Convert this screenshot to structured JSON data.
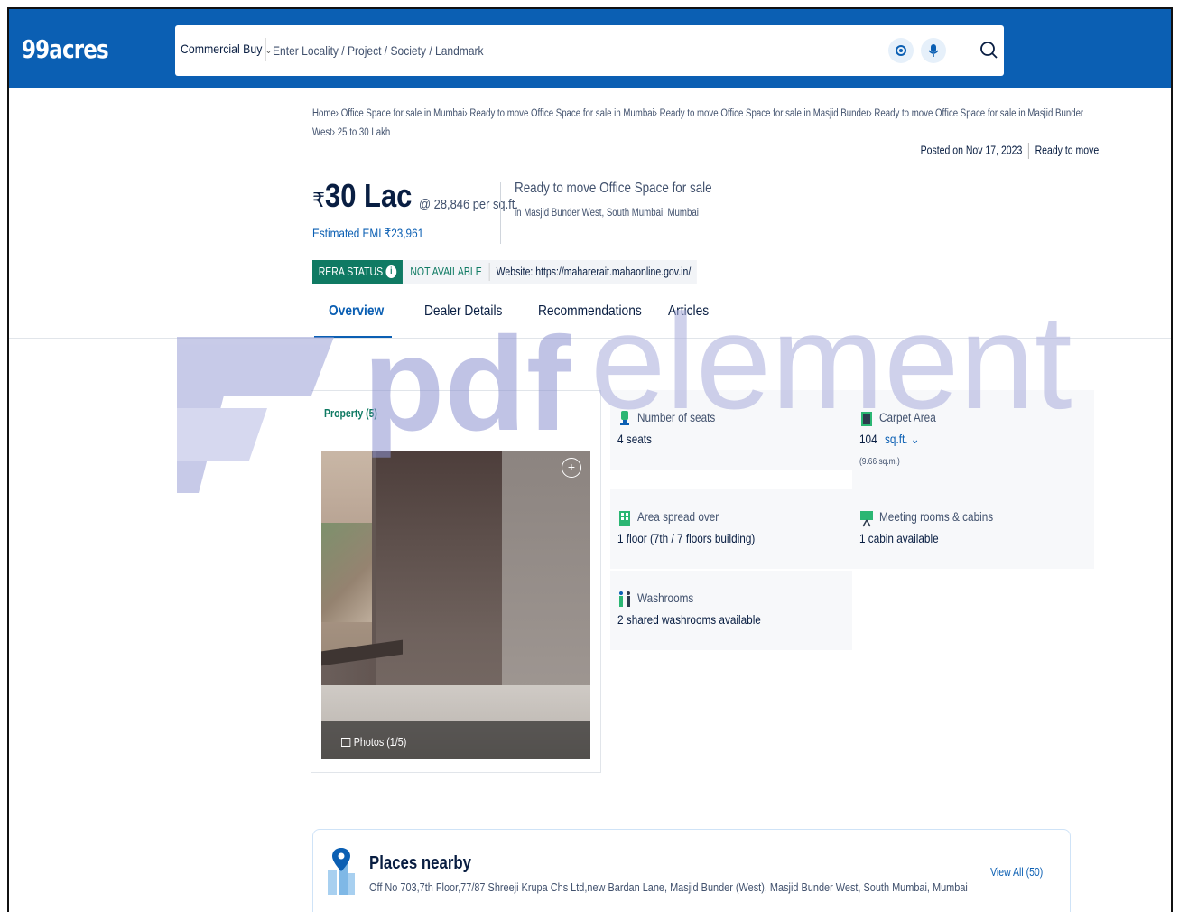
{
  "header": {
    "logo": "99acres",
    "category_select": "Commercial Buy",
    "search_placeholder": "Enter Locality / Project / Society / Landmark"
  },
  "breadcrumb": {
    "items": [
      "Home",
      "Office Space for sale in Mumbai",
      "Ready to move Office Space for sale in Mumbai",
      "Ready to move Office Space for sale in Masjid Bunder",
      "Ready to move Office Space for sale in Masjid Bunder West",
      "25 to 30 Lakh"
    ],
    "separator": "›"
  },
  "posted": {
    "date": "Posted on Nov 17, 2023",
    "status": "Ready to move"
  },
  "price": {
    "currency": "₹",
    "amount": "30 Lac",
    "per_sqft": "@ 28,846 per sq.ft.",
    "emi": "Estimated EMI ₹23,961"
  },
  "listing": {
    "title": "Ready to move Office Space for sale",
    "location": "in Masjid Bunder West, South Mumbai, Mumbai"
  },
  "rera": {
    "label": "RERA STATUS",
    "status": "NOT AVAILABLE",
    "website": "Website: https://maharerait.mahaonline.gov.in/"
  },
  "tabs": [
    {
      "label": "Overview",
      "active": true
    },
    {
      "label": "Dealer Details",
      "active": false
    },
    {
      "label": "Recommendations",
      "active": false
    },
    {
      "label": "Articles",
      "active": false
    }
  ],
  "gallery": {
    "label": "Property (5)",
    "photos_count": "Photos (1/5)"
  },
  "features": {
    "seats": {
      "label": "Number of seats",
      "value": "4 seats"
    },
    "carpet": {
      "label": "Carpet Area",
      "value": "104",
      "unit": "sq.ft.",
      "sub": "(9.66 sq.m.)"
    },
    "floors": {
      "label": "Area spread over",
      "value": "1 floor (7th / 7 floors building)"
    },
    "meeting": {
      "label": "Meeting rooms & cabins",
      "value": "1 cabin available"
    },
    "washrooms": {
      "label": "Washrooms",
      "value": "2 shared washrooms available"
    }
  },
  "places": {
    "title": "Places nearby",
    "address": "Off No 703,7th Floor,77/87 Shreeji Krupa Chs Ltd,new Bardan Lane, Masjid Bunder (West), Masjid Bunder West, South Mumbai, Mumbai",
    "view_all": "View All (50)"
  },
  "watermark": {
    "text_bold": "pdf",
    "text_light": "element"
  },
  "colors": {
    "brand_blue": "#0b5fb3",
    "rera_green": "#0f7a63",
    "text_dark": "#091e42",
    "text_muted": "#42526e",
    "watermark": "#c7c6e6"
  }
}
